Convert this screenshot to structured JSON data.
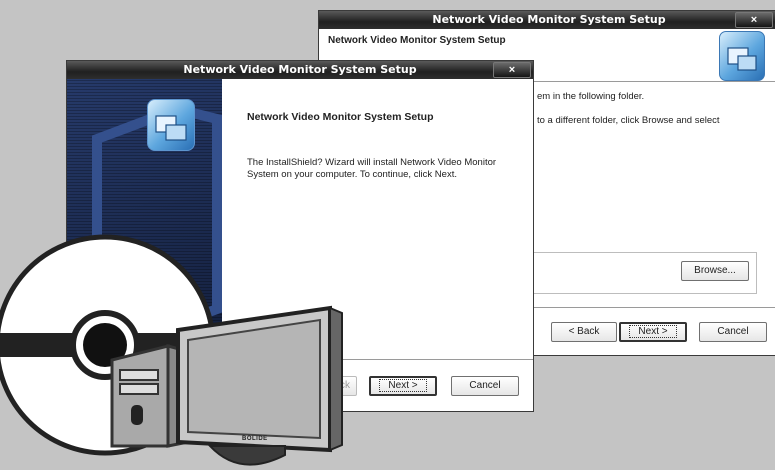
{
  "back_window": {
    "title": "Network Video Monitor System Setup",
    "close": "×",
    "header_title": "Network Video Monitor System Setup",
    "line1": "em in the following folder.",
    "line2": "to a different folder, click Browse and select",
    "browse": "Browse...",
    "back": "< Back",
    "next": "Next >",
    "cancel": "Cancel"
  },
  "front_window": {
    "title": "Network Video Monitor System Setup",
    "close": "×",
    "heading": "Network Video Monitor System Setup",
    "body": "The InstallShield? Wizard will install Network Video Monitor System on your computer. To continue, click Next.",
    "back_fragment": "ack",
    "next": "Next >",
    "cancel": "Cancel"
  },
  "monitor": {
    "brand": "BOLIDE"
  },
  "colors": {
    "wizard_panel": "#17223f",
    "background": "#c4c4c4",
    "titlebar": "#202020"
  }
}
